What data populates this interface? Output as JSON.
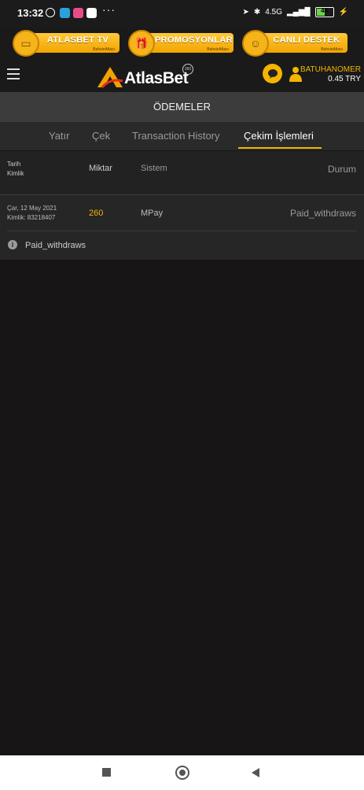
{
  "status_bar": {
    "time": "13:32",
    "dots": "···",
    "network": "4.5G",
    "battery": "46"
  },
  "promo": {
    "tv_label": "ATLASBET TV",
    "promo_label": "PROMOSYONLAR",
    "support_label": "CANLI DESTEK",
    "sub_label": "BahsinAtlası"
  },
  "header": {
    "logo_text": "AtlasBet",
    "logo_badge": "360",
    "username": "BATUHANOMER",
    "balance": "0.45 TRY"
  },
  "page_title": "ÖDEMELER",
  "tabs": [
    {
      "label": "Yatır"
    },
    {
      "label": "Çek"
    },
    {
      "label": "Transaction History"
    },
    {
      "label": "Çekim İşlemleri"
    }
  ],
  "table": {
    "headers": {
      "tarih": "Tarih",
      "kimlik": "Kimlik",
      "miktar": "Miktar",
      "sistem": "Sistem",
      "durum": "Durum"
    },
    "rows": [
      {
        "date": "Çar, 12 May 2021",
        "id": "Kimlik: 83218407",
        "amount": "260",
        "system": "MPay",
        "status": "Paid_withdraws"
      }
    ]
  },
  "info_text": "Paid_withdraws",
  "colors": {
    "accent": "#f4b400",
    "background": "#171515",
    "panel": "#262626"
  }
}
